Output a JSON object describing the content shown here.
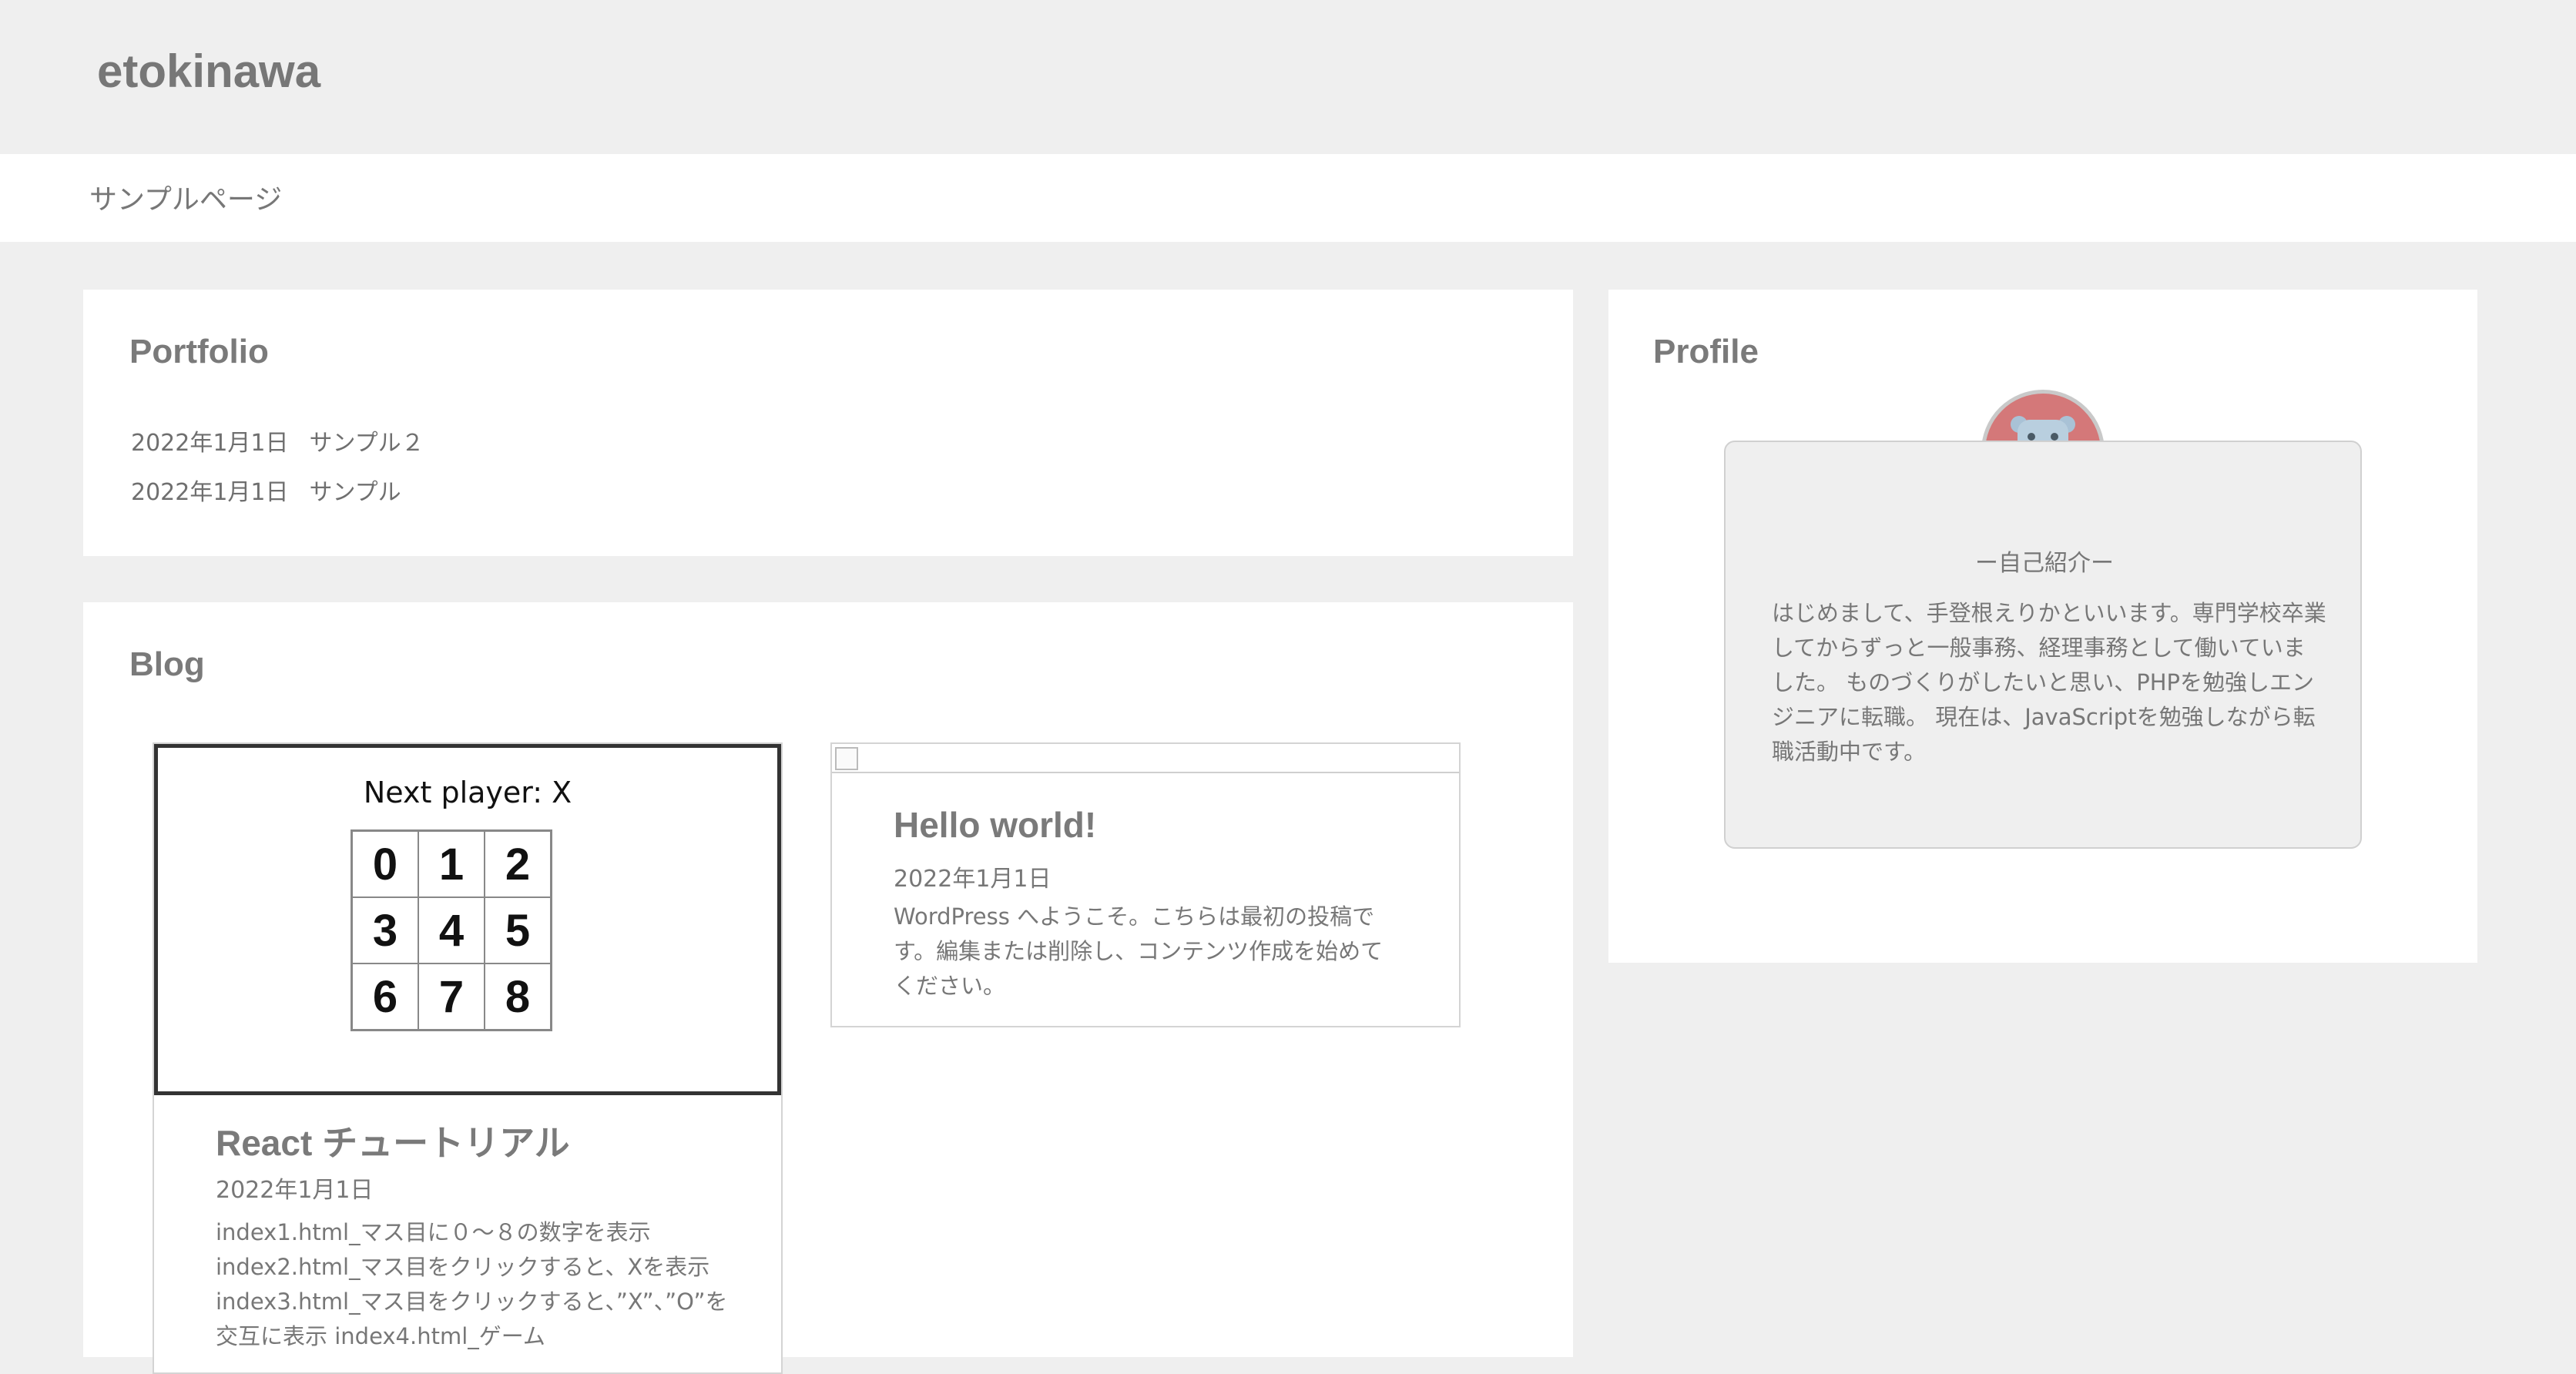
{
  "site": {
    "title": "etokinawa"
  },
  "nav": {
    "items": [
      {
        "label": "サンプルページ"
      }
    ]
  },
  "portfolio": {
    "title": "Portfolio",
    "items": [
      {
        "date": "2022年1月1日",
        "title": "サンプル２"
      },
      {
        "date": "2022年1月1日",
        "title": "サンプル"
      }
    ]
  },
  "blog": {
    "title": "Blog",
    "posts": [
      {
        "title": "React チュートリアル",
        "date": "2022年1月1日",
        "excerpt": "index1.html_マス目に０〜８の数字を表示 index2.html_マス目をクリックすると、Xを表示 index3.html_マス目をクリックすると、”X”、”O”を交互に表示 index4.html_ゲーム",
        "thumbnail": {
          "next_player": "Next player: X",
          "squares": [
            "0",
            "1",
            "2",
            "3",
            "4",
            "5",
            "6",
            "7",
            "8"
          ]
        }
      },
      {
        "title": "Hello world!",
        "date": "2022年1月1日",
        "excerpt": "WordPress へようこそ。こちらは最初の投稿です。編集または削除し、コンテンツ作成を始めてください。"
      }
    ]
  },
  "profile": {
    "title": "Profile",
    "heading": "ー自己紹介ー",
    "text": "はじめまして、手登根えりかといいます。専門学校卒業してからずっと一般事務、経理事務として働いていました。 ものづくりがしたいと思い、PHPを勉強しエンジニアに転職。 現在は、JavaScriptを勉強しながら転職活動中です。",
    "avatar_icon": "hippo-avatar-icon"
  },
  "colors": {
    "page_bg": "#efefef",
    "panel_bg": "#ffffff",
    "avatar_bg": "#d47879"
  }
}
